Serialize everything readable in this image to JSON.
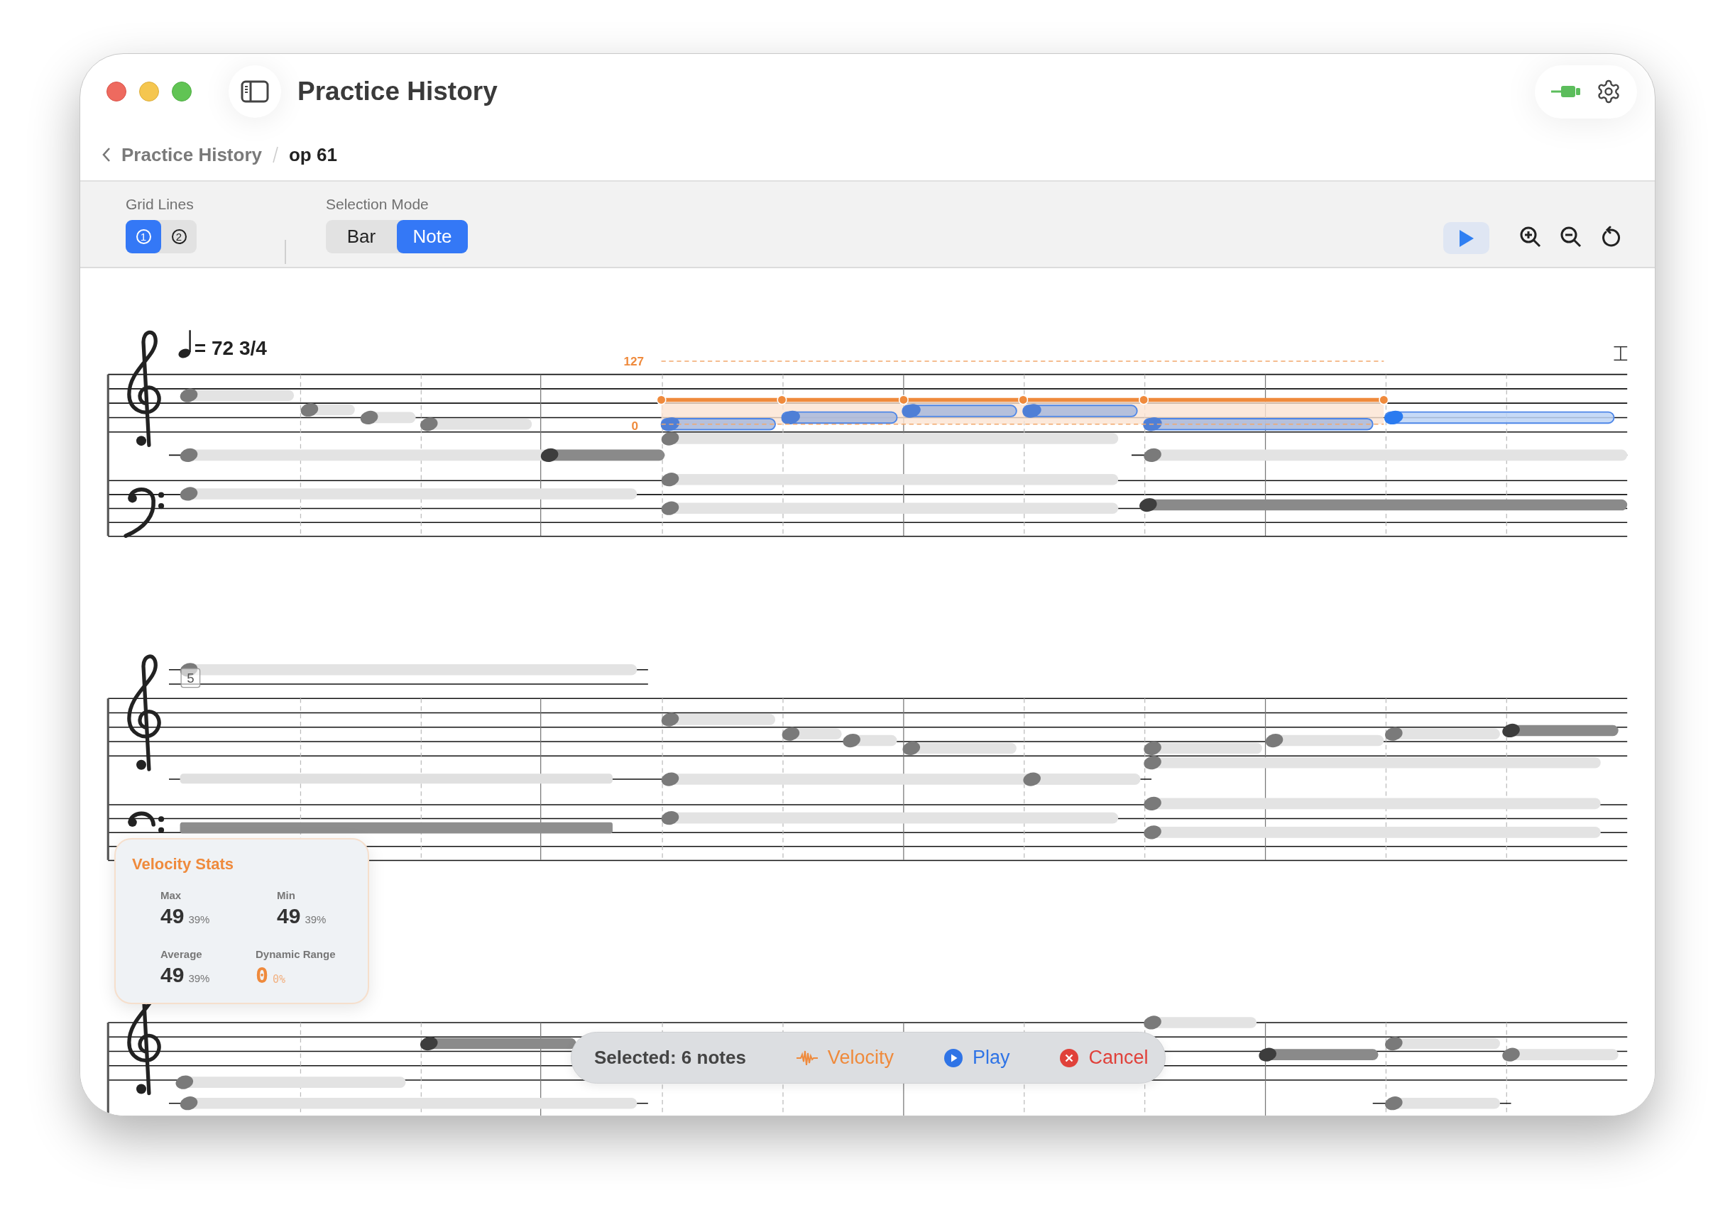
{
  "window": {
    "title": "Practice History"
  },
  "breadcrumb": [
    {
      "label": "Practice History",
      "kind": "link"
    },
    {
      "label": "op 61",
      "kind": "current"
    }
  ],
  "toolbar": {
    "grid_lines": {
      "label": "Grid Lines",
      "options": [
        {
          "label": "1",
          "selected": true
        },
        {
          "label": "2",
          "selected": false
        }
      ]
    },
    "selection_mode": {
      "label": "Selection Mode",
      "options": [
        {
          "label": "Bar",
          "selected": false
        },
        {
          "label": "Note",
          "selected": true
        }
      ]
    }
  },
  "score": {
    "tempo": "= 72 3/4",
    "velocity_max_label": "127",
    "velocity_min_label": "0",
    "measure_numbers": [
      "5"
    ]
  },
  "velocity_stats": {
    "title": "Velocity Stats",
    "stats": [
      {
        "label": "Max",
        "value": "49",
        "percent": "39%",
        "kind": "normal"
      },
      {
        "label": "Min",
        "value": "49",
        "percent": "39%",
        "kind": "normal"
      },
      {
        "label": "Average",
        "value": "49",
        "percent": "39%",
        "kind": "normal"
      },
      {
        "label": "Dynamic Range",
        "value": "0",
        "percent": "0%",
        "kind": "accent"
      }
    ]
  },
  "selection_bar": {
    "summary": "Selected: 6 notes",
    "actions": [
      {
        "label": "Velocity",
        "kind": "velocity"
      },
      {
        "label": "Play",
        "kind": "play"
      },
      {
        "label": "Cancel",
        "kind": "cancel"
      }
    ]
  }
}
